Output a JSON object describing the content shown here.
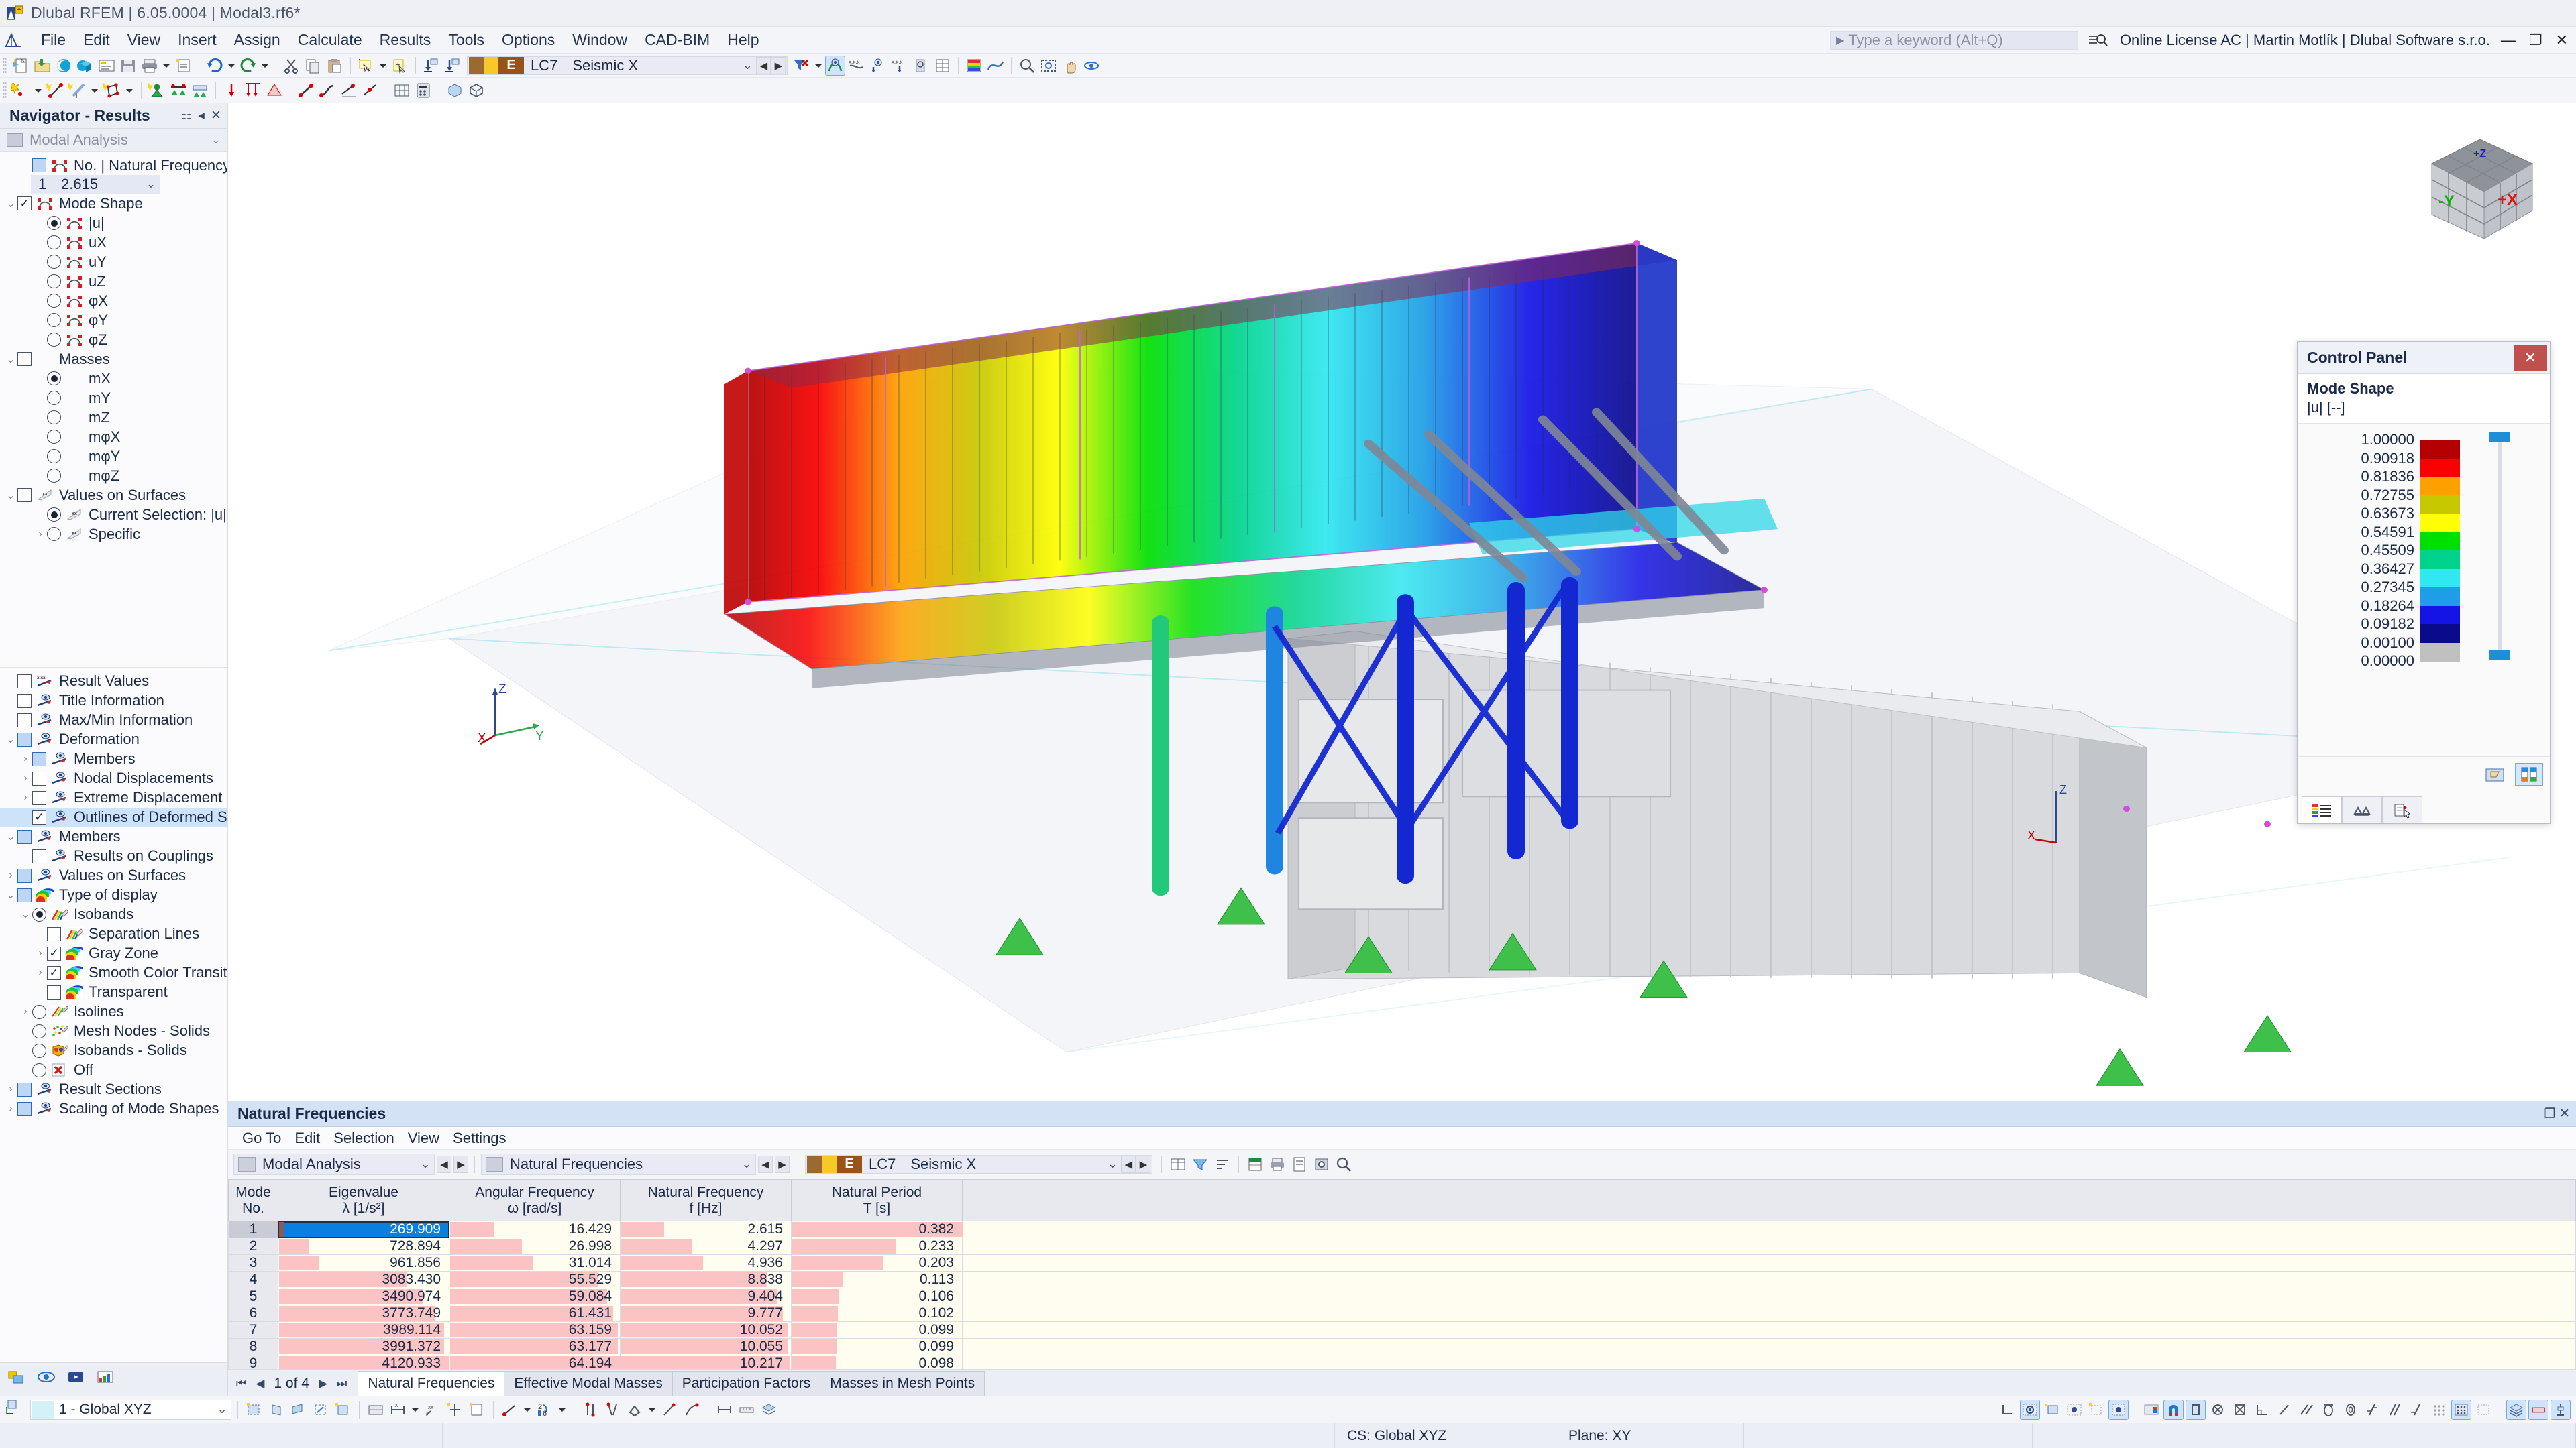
{
  "window": {
    "title": "Dlubal RFEM | 6.05.0004 | Modal3.rf6*",
    "keyword_placeholder": "Type a keyword (Alt+Q)",
    "license": "Online License AC | Martin Motlík | Dlubal Software s.r.o.",
    "minimize": "—",
    "restore": "❐",
    "close": "✕"
  },
  "menu": {
    "items": [
      "File",
      "Edit",
      "View",
      "Insert",
      "Assign",
      "Calculate",
      "Results",
      "Tools",
      "Options",
      "Window",
      "CAD-BIM",
      "Help"
    ]
  },
  "toolbar": {
    "load_case_code": "E",
    "load_case_no": "LC7",
    "load_case_name": "Seismic X"
  },
  "navigator": {
    "title": "Navigator - Results",
    "combo": "Modal Analysis",
    "top_tree": [
      {
        "label": "No. | Natural Frequency f [Hz]",
        "indent": 1,
        "control": "checkbox-blue",
        "icon": "mode-shape-icon"
      },
      {
        "label": "Mode Shape",
        "indent": 0,
        "control": "checkbox-checked",
        "icon": "mode-shape-icon",
        "expander": "v"
      },
      {
        "label": "|u|",
        "indent": 2,
        "control": "radio-on",
        "icon": "mode-shape-icon"
      },
      {
        "label": "uX",
        "indent": 2,
        "control": "radio",
        "icon": "mode-shape-icon"
      },
      {
        "label": "uY",
        "indent": 2,
        "control": "radio",
        "icon": "mode-shape-icon"
      },
      {
        "label": "uZ",
        "indent": 2,
        "control": "radio",
        "icon": "mode-shape-icon"
      },
      {
        "label": "φX",
        "indent": 2,
        "control": "radio",
        "icon": "mode-shape-icon"
      },
      {
        "label": "φY",
        "indent": 2,
        "control": "radio",
        "icon": "mode-shape-icon"
      },
      {
        "label": "φZ",
        "indent": 2,
        "control": "radio",
        "icon": "mode-shape-icon"
      },
      {
        "label": "Masses",
        "indent": 0,
        "control": "checkbox",
        "icon": "none",
        "expander": "v"
      },
      {
        "label": "mX",
        "indent": 2,
        "control": "radio-on",
        "icon": "none"
      },
      {
        "label": "mY",
        "indent": 2,
        "control": "radio",
        "icon": "none"
      },
      {
        "label": "mZ",
        "indent": 2,
        "control": "radio",
        "icon": "none"
      },
      {
        "label": "mφX",
        "indent": 2,
        "control": "radio",
        "icon": "none"
      },
      {
        "label": "mφY",
        "indent": 2,
        "control": "radio",
        "icon": "none"
      },
      {
        "label": "mφZ",
        "indent": 2,
        "control": "radio",
        "icon": "none"
      },
      {
        "label": "Values on Surfaces",
        "indent": 0,
        "control": "checkbox",
        "icon": "xx-flag-icon",
        "expander": "v"
      },
      {
        "label": "Current Selection: |u|",
        "indent": 2,
        "control": "radio-on",
        "icon": "xx-flag-icon"
      },
      {
        "label": "Specific",
        "indent": 2,
        "control": "radio",
        "icon": "xx-flag-icon",
        "expander": ">"
      }
    ],
    "frequency_row": {
      "no": "1",
      "value": "2.615"
    },
    "bottom_tree": [
      {
        "label": "Result Values",
        "indent": 0,
        "control": "checkbox",
        "icon": "xxx-tag-icon"
      },
      {
        "label": "Title Information",
        "indent": 0,
        "control": "checkbox",
        "icon": "eye-tag-icon"
      },
      {
        "label": "Max/Min Information",
        "indent": 0,
        "control": "checkbox",
        "icon": "eye-tag-icon"
      },
      {
        "label": "Deformation",
        "indent": 0,
        "control": "checkbox-blue",
        "icon": "eye-tag-icon",
        "expander": "v"
      },
      {
        "label": "Members",
        "indent": 1,
        "control": "checkbox-blue",
        "icon": "eye-tag-icon",
        "expander": ">"
      },
      {
        "label": "Nodal Displacements",
        "indent": 1,
        "control": "checkbox",
        "icon": "eye-tag-icon",
        "expander": ">"
      },
      {
        "label": "Extreme Displacement",
        "indent": 1,
        "control": "checkbox",
        "icon": "eye-tag-icon",
        "expander": ">"
      },
      {
        "label": "Outlines of Deformed Surfaces",
        "indent": 1,
        "control": "checkbox-checked",
        "icon": "eye-tag-icon",
        "selected": true
      },
      {
        "label": "Members",
        "indent": 0,
        "control": "checkbox-blue",
        "icon": "eye-tag-icon",
        "expander": "v"
      },
      {
        "label": "Results on Couplings",
        "indent": 1,
        "control": "checkbox",
        "icon": "eye-tag-icon"
      },
      {
        "label": "Values on Surfaces",
        "indent": 0,
        "control": "checkbox-blue",
        "icon": "eye-tag-icon",
        "expander": ">"
      },
      {
        "label": "Type of display",
        "indent": 0,
        "control": "checkbox-blue",
        "icon": "rainbow-icon",
        "expander": "v"
      },
      {
        "label": "Isobands",
        "indent": 1,
        "control": "radio-on",
        "icon": "rainbow-pencil-icon",
        "expander": "v"
      },
      {
        "label": "Separation Lines",
        "indent": 2,
        "control": "checkbox",
        "icon": "rainbow-pencil-icon"
      },
      {
        "label": "Gray Zone",
        "indent": 2,
        "control": "checkbox-checked",
        "icon": "rainbow-icon",
        "expander": ">"
      },
      {
        "label": "Smooth Color Transition",
        "indent": 2,
        "control": "checkbox-checked",
        "icon": "rainbow-icon",
        "expander": ">"
      },
      {
        "label": "Transparent",
        "indent": 2,
        "control": "checkbox",
        "icon": "rainbow-icon"
      },
      {
        "label": "Isolines",
        "indent": 1,
        "control": "radio",
        "icon": "isolines-icon",
        "expander": ">"
      },
      {
        "label": "Mesh Nodes - Solids",
        "indent": 1,
        "control": "radio",
        "icon": "mesh-nodes-icon"
      },
      {
        "label": "Isobands - Solids",
        "indent": 1,
        "control": "radio",
        "icon": "isobands-solids-icon"
      },
      {
        "label": "Off",
        "indent": 1,
        "control": "radio",
        "icon": "red-x-icon"
      },
      {
        "label": "Result Sections",
        "indent": 0,
        "control": "checkbox-blue",
        "icon": "eye-tag-icon",
        "expander": ">"
      },
      {
        "label": "Scaling of Mode Shapes",
        "indent": 0,
        "control": "checkbox-blue",
        "icon": "eye-tag-icon",
        "expander": ">"
      }
    ]
  },
  "control_panel": {
    "title": "Control Panel",
    "close_label": "✕",
    "subtitle_line1": "Mode Shape",
    "subtitle_line2": "|u| [--]",
    "legend_values": [
      "1.00000",
      "0.90918",
      "0.81836",
      "0.72755",
      "0.63673",
      "0.54591",
      "0.45509",
      "0.36427",
      "0.27345",
      "0.18264",
      "0.09182",
      "0.00100",
      "0.00000"
    ],
    "legend_colors": [
      "#b40000",
      "#fa0000",
      "#ffa000",
      "#c8c800",
      "#ffff00",
      "#00e000",
      "#00d48c",
      "#30e8f0",
      "#1e9ee6",
      "#1414e6",
      "#0a0a8c",
      "#c0c0c0"
    ]
  },
  "viewport": {
    "axis_z": "Z",
    "axis_x": "X",
    "axis_y": "Y",
    "cube_x": "+X",
    "cube_y": "-Y",
    "cube_z": "+Z"
  },
  "table_panel": {
    "title": "Natural Frequencies",
    "menu": [
      "Go To",
      "Edit",
      "Selection",
      "View",
      "Settings"
    ],
    "combo1": "Modal Analysis",
    "combo2": "Natural Frequencies",
    "load_case_code": "E",
    "load_case_no": "LC7",
    "load_case_name": "Seismic X",
    "pager": "1 of 4",
    "tabs": [
      "Natural Frequencies",
      "Effective Modal Masses",
      "Participation Factors",
      "Masses in Mesh Points"
    ],
    "selected_tab": "Natural Frequencies",
    "columns": [
      {
        "l1": "Mode",
        "l2": "No."
      },
      {
        "l1": "Eigenvalue",
        "l2": "λ [1/s²]"
      },
      {
        "l1": "Angular Frequency",
        "l2": "ω [rad/s]"
      },
      {
        "l1": "Natural Frequency",
        "l2": "f [Hz]"
      },
      {
        "l1": "Natural Period",
        "l2": "T [s]"
      },
      {
        "l1": "",
        "l2": ""
      }
    ],
    "rows": [
      {
        "mode": "1",
        "eigenvalue": "269.909",
        "angular": "16.429",
        "freq": "2.615",
        "period": "0.382"
      },
      {
        "mode": "2",
        "eigenvalue": "728.894",
        "angular": "26.998",
        "freq": "4.297",
        "period": "0.233"
      },
      {
        "mode": "3",
        "eigenvalue": "961.856",
        "angular": "31.014",
        "freq": "4.936",
        "period": "0.203"
      },
      {
        "mode": "4",
        "eigenvalue": "3083.430",
        "angular": "55.529",
        "freq": "8.838",
        "period": "0.113"
      },
      {
        "mode": "5",
        "eigenvalue": "3490.974",
        "angular": "59.084",
        "freq": "9.404",
        "period": "0.106"
      },
      {
        "mode": "6",
        "eigenvalue": "3773.749",
        "angular": "61.431",
        "freq": "9.777",
        "period": "0.102"
      },
      {
        "mode": "7",
        "eigenvalue": "3989.114",
        "angular": "63.159",
        "freq": "10.052",
        "period": "0.099"
      },
      {
        "mode": "8",
        "eigenvalue": "3991.372",
        "angular": "63.177",
        "freq": "10.055",
        "period": "0.099"
      },
      {
        "mode": "9",
        "eigenvalue": "4120.933",
        "angular": "64.194",
        "freq": "10.217",
        "period": "0.098"
      }
    ]
  },
  "status_bar": {
    "cs_combo": "1 - Global XYZ",
    "cs": "CS: Global XYZ",
    "plane": "Plane: XY"
  },
  "chart_data": {
    "type": "table",
    "title": "Natural Frequencies",
    "columns": [
      "Mode No.",
      "Eigenvalue λ [1/s²]",
      "Angular Frequency ω [rad/s]",
      "Natural Frequency f [Hz]",
      "Natural Period T [s]"
    ],
    "rows": [
      [
        1,
        269.909,
        16.429,
        2.615,
        0.382
      ],
      [
        2,
        728.894,
        26.998,
        4.297,
        0.233
      ],
      [
        3,
        961.856,
        31.014,
        4.936,
        0.203
      ],
      [
        4,
        3083.43,
        55.529,
        8.838,
        0.113
      ],
      [
        5,
        3490.974,
        59.084,
        9.404,
        0.106
      ],
      [
        6,
        3773.749,
        61.431,
        9.777,
        0.102
      ],
      [
        7,
        3989.114,
        63.159,
        10.052,
        0.099
      ],
      [
        8,
        3991.372,
        63.177,
        10.055,
        0.099
      ],
      [
        9,
        4120.933,
        64.194,
        10.217,
        0.098
      ]
    ]
  }
}
